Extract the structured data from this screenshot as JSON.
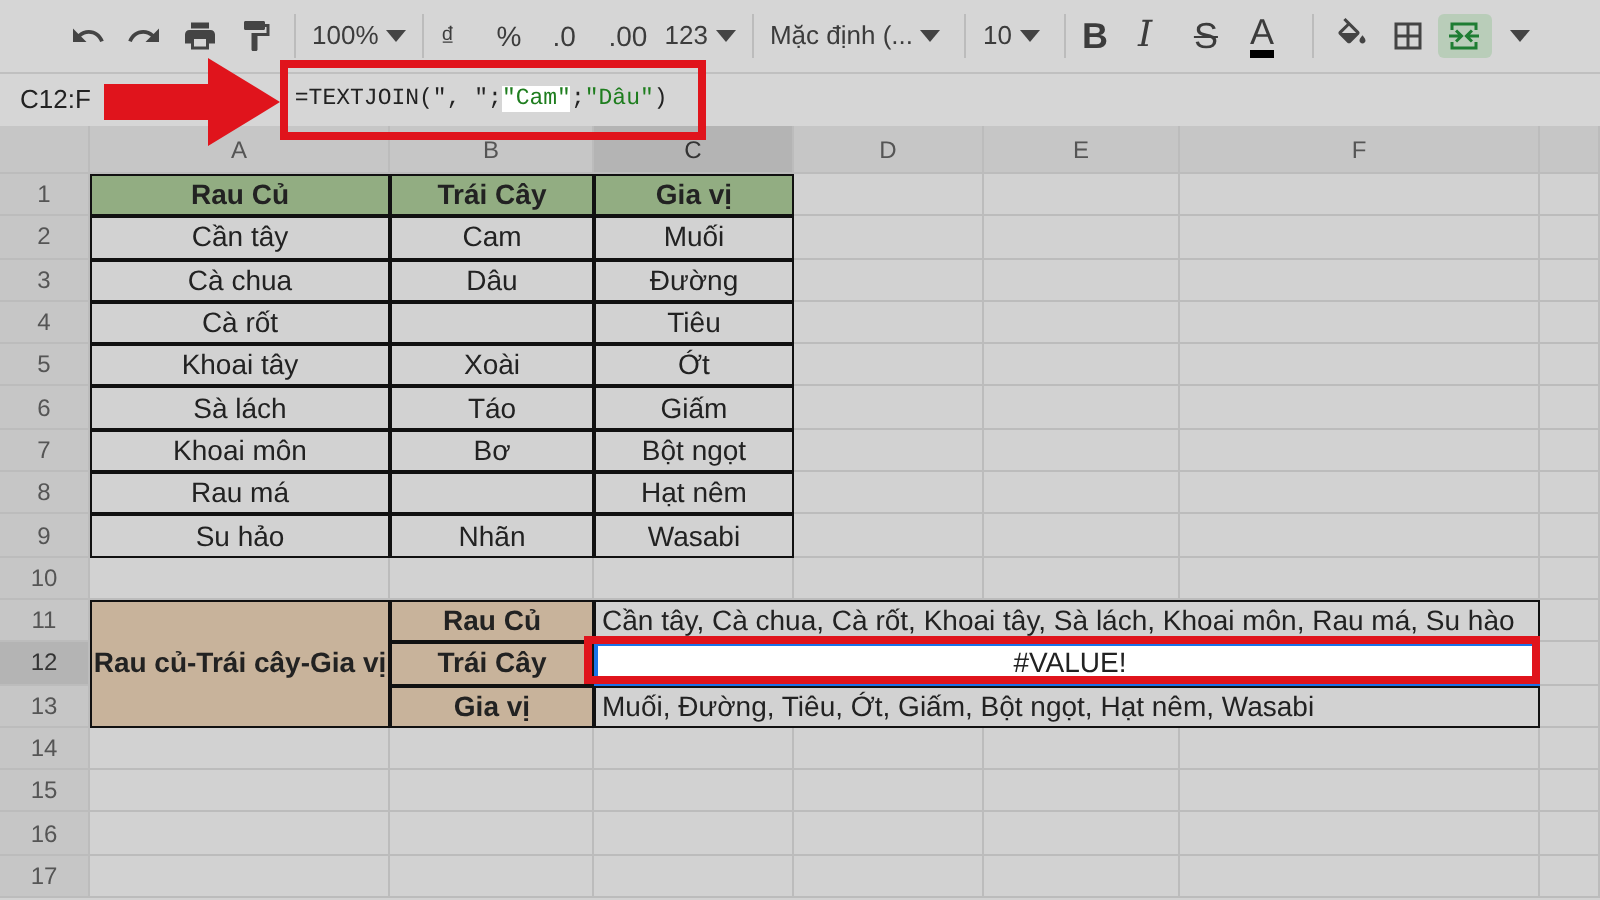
{
  "toolbar": [
    {
      "kind": "undo",
      "active": false
    },
    {
      "kind": "redo",
      "active": false
    },
    {
      "kind": "print",
      "active": false
    },
    {
      "kind": "paint",
      "active": false
    },
    {
      "kind": "sep"
    },
    {
      "kind": "select",
      "text": "100%",
      "active": false
    },
    {
      "kind": "sep"
    },
    {
      "kind": "text",
      "text": "₫",
      "active": false
    },
    {
      "kind": "text",
      "text": "%",
      "active": false
    },
    {
      "kind": "text",
      "text": ".0",
      "active": false
    },
    {
      "kind": "text",
      "text": ".00",
      "active": false
    },
    {
      "kind": "select",
      "text": "123",
      "active": false
    },
    {
      "kind": "sep"
    },
    {
      "kind": "select",
      "text": "Mặc định (...",
      "active": false
    },
    {
      "kind": "sep"
    },
    {
      "kind": "select",
      "text": "10",
      "active": false
    },
    {
      "kind": "sep"
    },
    {
      "kind": "bold",
      "text": "B",
      "active": false
    },
    {
      "kind": "italic",
      "text": "I",
      "active": false
    },
    {
      "kind": "strike",
      "text": "S",
      "active": false
    },
    {
      "kind": "textcolor",
      "text": "A",
      "active": false
    },
    {
      "kind": "sep"
    },
    {
      "kind": "fill",
      "active": false
    },
    {
      "kind": "borders",
      "active": false
    },
    {
      "kind": "merge",
      "active": true
    },
    {
      "kind": "caret",
      "active": false
    }
  ],
  "formula_bar": {
    "name_box": "C12:F",
    "formula": [
      {
        "text": "=TEXTJOIN(\", \";",
        "kind": "plain",
        "highlighted": false
      },
      {
        "text": "\"Cam\"",
        "kind": "string",
        "highlighted": true
      },
      {
        "text": ";",
        "kind": "plain",
        "highlighted": false
      },
      {
        "text": "\"Dâu\"",
        "kind": "string",
        "highlighted": false
      },
      {
        "text": ")",
        "kind": "plain",
        "highlighted": false
      }
    ]
  },
  "columns": [
    {
      "label": "A",
      "selected": false
    },
    {
      "label": "B",
      "selected": false
    },
    {
      "label": "C",
      "selected": true
    },
    {
      "label": "D",
      "selected": false
    },
    {
      "label": "E",
      "selected": false
    },
    {
      "label": "F",
      "selected": false
    }
  ],
  "row_numbers": [
    {
      "label": "1",
      "selected": false
    },
    {
      "label": "2",
      "selected": false
    },
    {
      "label": "3",
      "selected": false
    },
    {
      "label": "4",
      "selected": false
    },
    {
      "label": "5",
      "selected": false
    },
    {
      "label": "6",
      "selected": false
    },
    {
      "label": "7",
      "selected": false
    },
    {
      "label": "8",
      "selected": false
    },
    {
      "label": "9",
      "selected": false
    },
    {
      "label": "10",
      "selected": false
    },
    {
      "label": "11",
      "selected": false
    },
    {
      "label": "12",
      "selected": true
    },
    {
      "label": "13",
      "selected": false
    },
    {
      "label": "14",
      "selected": false
    },
    {
      "label": "15",
      "selected": false
    },
    {
      "label": "16",
      "selected": false
    },
    {
      "label": "17",
      "selected": false
    }
  ],
  "table": {
    "header": [
      "Rau Củ",
      "Trái Cây",
      "Gia vị"
    ],
    "rows": [
      [
        "Cần tây",
        "Cam",
        "Muối"
      ],
      [
        "Cà chua",
        "Dâu",
        "Đường"
      ],
      [
        "Cà rốt",
        null,
        "Tiêu"
      ],
      [
        "Khoai tây",
        "Xoài",
        "Ớt"
      ],
      [
        "Sà lách",
        "Táo",
        "Giấm"
      ],
      [
        "Khoai môn",
        "Bơ",
        "Bột ngọt"
      ],
      [
        "Rau má",
        null,
        "Hạt nêm"
      ],
      [
        "Su hảo",
        "Nhãn",
        "Wasabi"
      ]
    ]
  },
  "summary": {
    "label": "Rau củ-Trái cây-Gia vị",
    "rows": [
      {
        "category": "Rau Củ",
        "result": "Cần tây, Cà chua, Cà rốt, Khoai tây, Sà lách, Khoai môn, Rau má, Su hào",
        "selected": false
      },
      {
        "category": "Trái Cây",
        "result": "#VALUE!",
        "selected": true
      },
      {
        "category": "Gia vị",
        "result": "Muối, Đường, Tiêu, Ớt, Giấm, Bột ngọt, Hạt nêm, Wasabi",
        "selected": false
      }
    ]
  }
}
